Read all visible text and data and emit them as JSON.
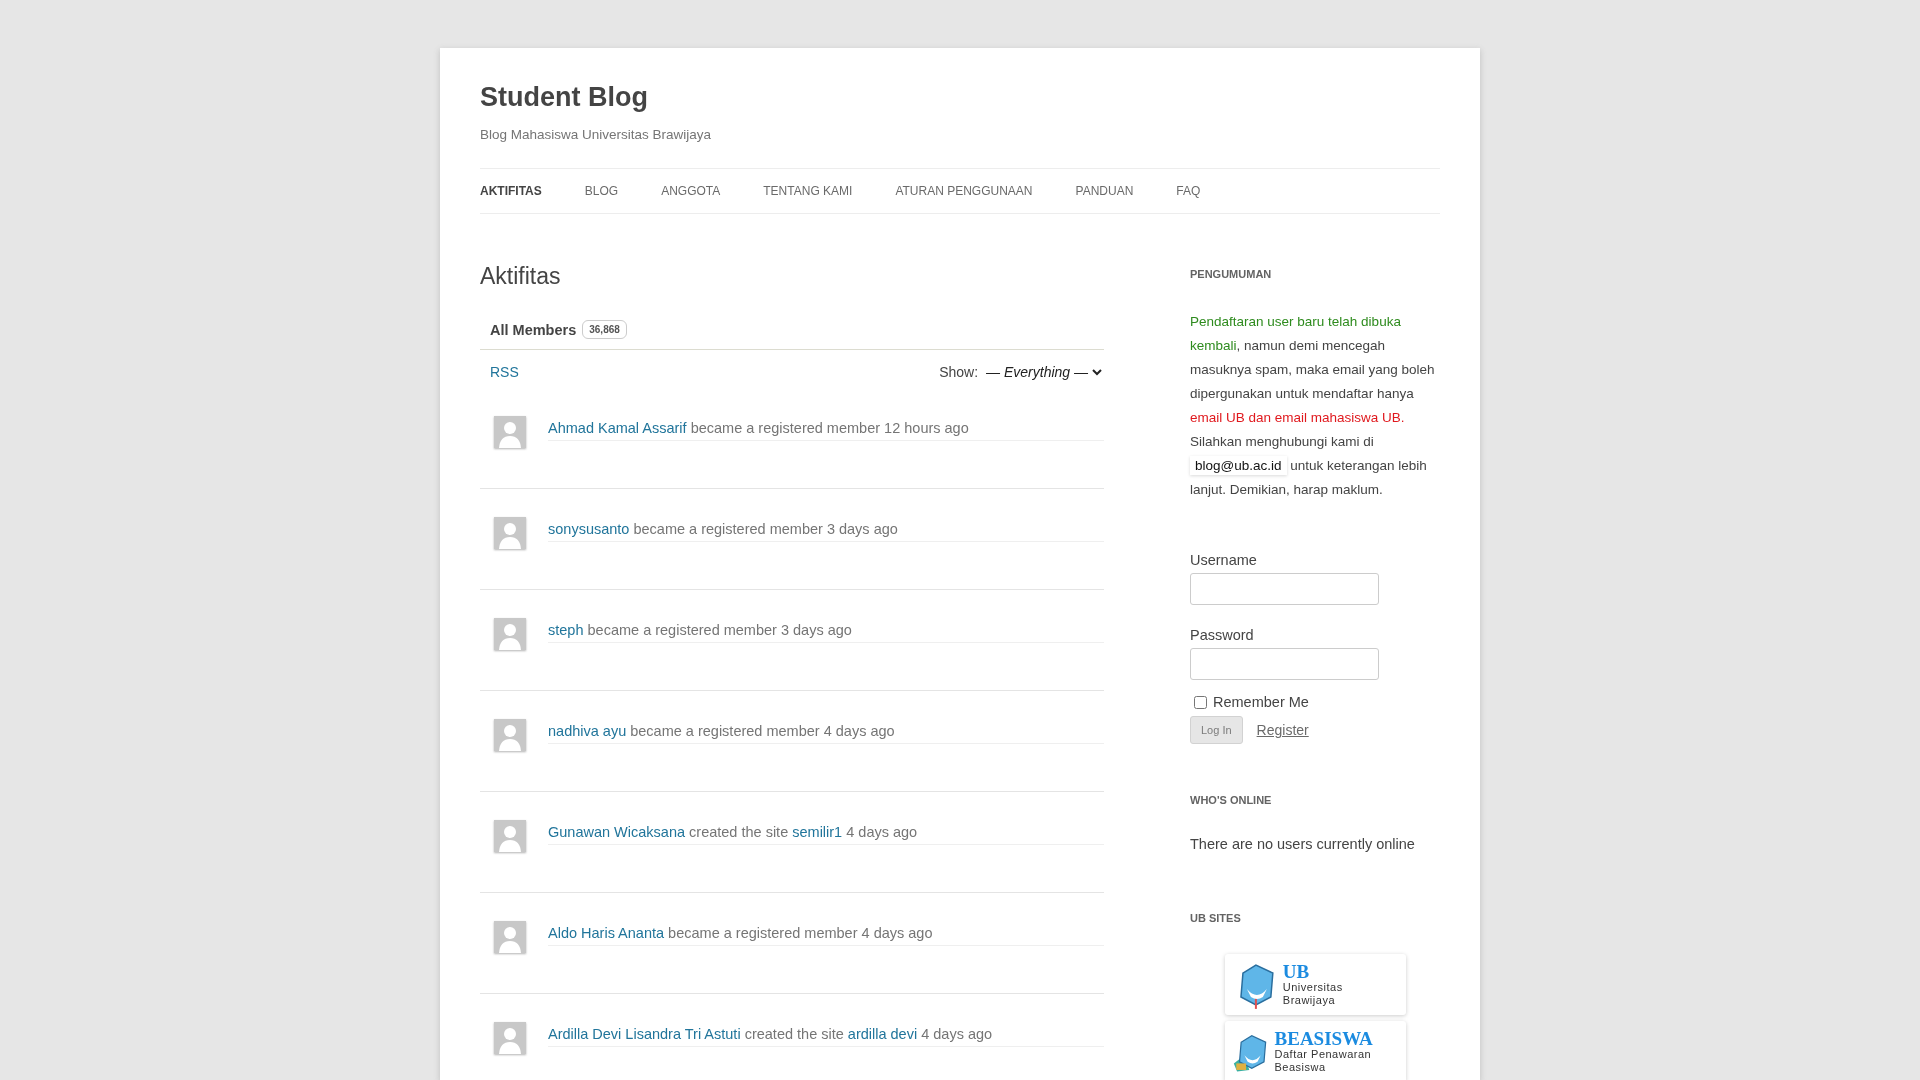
{
  "site": {
    "title": "Student Blog",
    "tagline": "Blog Mahasiswa Universitas Brawijaya"
  },
  "nav": [
    {
      "label": "AKTIFITAS",
      "selected": true
    },
    {
      "label": "BLOG",
      "selected": false
    },
    {
      "label": "ANGGOTA",
      "selected": false
    },
    {
      "label": "TENTANG KAMI",
      "selected": false
    },
    {
      "label": "ATURAN PENGGUNAAN",
      "selected": false
    },
    {
      "label": "PANDUAN",
      "selected": false
    },
    {
      "label": "FAQ",
      "selected": false
    }
  ],
  "page_title": "Aktifitas",
  "tab": {
    "label": "All Members",
    "count": "36,868"
  },
  "rss": "RSS",
  "filter": {
    "label": "Show:",
    "value": "— Everything —"
  },
  "activities": [
    {
      "actor": "Ahmad Kamal Assarif",
      "action": "became a registered member",
      "time": "12 hours ago"
    },
    {
      "actor": "sonysusanto",
      "action": "became a registered member",
      "time": "3 days ago"
    },
    {
      "actor": "steph",
      "action": "became a registered member",
      "time": "3 days ago"
    },
    {
      "actor": "nadhiva ayu",
      "action": "became a registered member",
      "time": "4 days ago"
    },
    {
      "actor": "Gunawan Wicaksana",
      "action": "created the site",
      "site": "semilir1",
      "time": "4 days ago"
    },
    {
      "actor": "Aldo Haris Ananta",
      "action": "became a registered member",
      "time": "4 days ago"
    },
    {
      "actor": "Ardilla Devi Lisandra Tri Astuti",
      "action": "created the site",
      "site": "ardilla devi",
      "time": "4 days ago"
    }
  ],
  "sidebar": {
    "announcement": {
      "title": "PENGUMUMAN",
      "parts": [
        {
          "kind": "green",
          "text": "Pendaftaran user baru telah dibuka kembali"
        },
        {
          "kind": "plain",
          "text": ", namun demi mencegah masuknya spam, maka email yang boleh dipergunakan untuk mendaftar hanya "
        },
        {
          "kind": "red",
          "text": "email UB dan email mahasiswa UB."
        },
        {
          "kind": "plain",
          "text": " Silahkan menghubungi kami di "
        },
        {
          "kind": "code",
          "text": "blog@ub.ac.id"
        },
        {
          "kind": "plain",
          "text": " untuk keterangan lebih lanjut. Demikian, harap maklum."
        }
      ]
    },
    "login": {
      "username_label": "Username",
      "password_label": "Password",
      "remember": {
        "label": "Remember Me",
        "checked": false
      },
      "submit": "Log In",
      "register": "Register"
    },
    "online": {
      "title": "WHO'S ONLINE",
      "text": "There are no users currently online"
    },
    "sites": {
      "title": "UB SITES",
      "items": [
        {
          "name": "UB",
          "caption": "Universitas Brawijaya"
        },
        {
          "name": "BEASISWA",
          "caption": "Daftar Penawaran Beasiswa"
        }
      ]
    }
  }
}
